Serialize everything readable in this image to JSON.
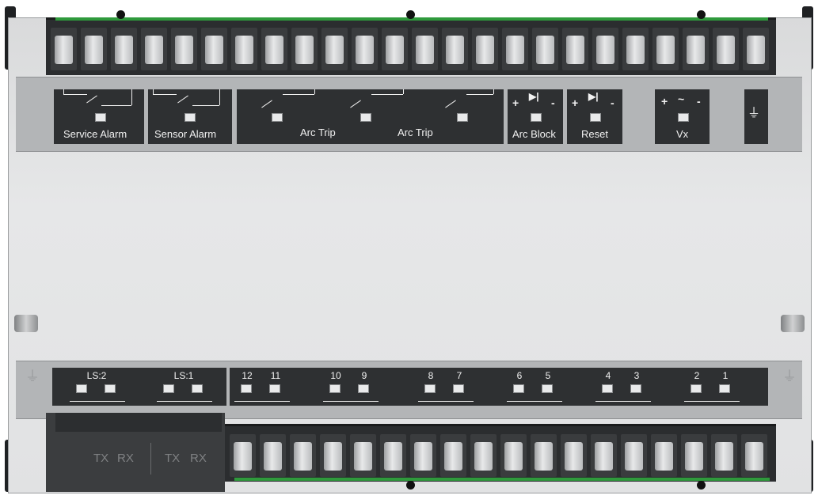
{
  "top_labels": {
    "service_alarm": "Service Alarm",
    "sensor_alarm": "Sensor Alarm",
    "arc_trip_1": "Arc Trip",
    "arc_trip_2": "Arc Trip",
    "arc_block": "Arc Block",
    "reset": "Reset",
    "vx": "Vx",
    "plus": "+",
    "minus": "-",
    "tilde": "~"
  },
  "bottom_labels": {
    "ls2": "LS:2",
    "ls1": "LS:1",
    "channels": [
      "12",
      "11",
      "10",
      "9",
      "8",
      "7",
      "6",
      "5",
      "4",
      "3",
      "2",
      "1"
    ]
  },
  "fiber_port": {
    "tx1": "TX",
    "rx1": "RX",
    "tx2": "TX",
    "rx2": "RX"
  },
  "colors": {
    "panel": "#e1e2e3",
    "label_band": "#b3b5b7",
    "group_fill": "#2e3032",
    "terminal": "#2b2d2f",
    "pcb_green": "#2f9a3c"
  }
}
